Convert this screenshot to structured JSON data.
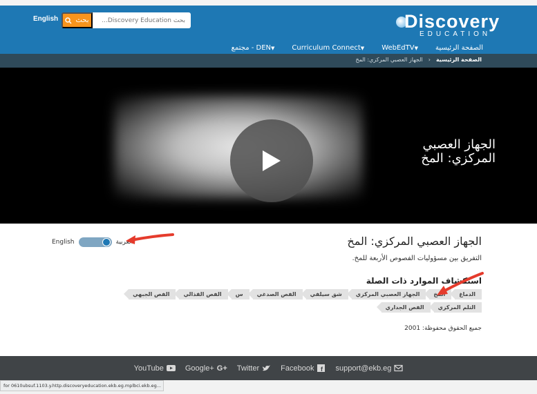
{
  "header": {
    "lang_link": "English",
    "search_button": "بحث",
    "search_placeholder": "بحث Discovery Education...",
    "logo_main": "Discovery",
    "logo_sub": "EDUCATION",
    "nav": [
      {
        "label": "الصفحة الرئيسية"
      },
      {
        "label": "WebEdTV"
      },
      {
        "label": "Curriculum Connect"
      },
      {
        "label": "DEN - مجتمع"
      }
    ]
  },
  "breadcrumb": {
    "home": "الصفحة الرئيسية",
    "current": "الجهاز العصبي المركزي: المخ"
  },
  "video": {
    "title": "الجهاز العصبي المركزي: المخ"
  },
  "main": {
    "toggle_left": "English",
    "toggle_right": "العربية",
    "page_title": "الجهاز العصبي المركزي: المخ",
    "subtitle": "التفريق بين مسؤوليات الفصوص الأربعة للمخ.",
    "related_title": "استكشاف الموارد ذات الصلة",
    "tags": [
      "الدماغ",
      "المخ",
      "الجهاز العصبي المركزي",
      "شق سيلفي",
      "الفص الصدغي",
      "س",
      "الفص القذالي",
      "الفص الجبهي",
      "التلم المركزي",
      "الفص الجداري"
    ],
    "copyright": "جميع الحقوق محفوظة: 2001"
  },
  "footer": {
    "links": [
      "YouTube",
      "Google+",
      "Twitter",
      "Facebook",
      "support@ekb.eg"
    ]
  },
  "status_text": "for 0610ubsuf.1103.y.http.discoveryeducation.ekb.eg.mplbci.ekb.eg...",
  "colors": {
    "header_bg": "#1e78b4",
    "search_button": "#f7941d",
    "breadcrumb_bg": "#2f4a5a",
    "footer_bg": "#404447",
    "arrow": "#e53b2c"
  }
}
